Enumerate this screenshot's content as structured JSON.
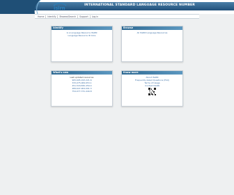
{
  "header": {
    "title": "INTERNATIONAL STANDARD LANGUAGE RESOURCE NUMBER",
    "logo_text": "islrn"
  },
  "nav": {
    "items": [
      "Home",
      "Identify",
      "Browse/Search",
      "Support",
      "Log in"
    ]
  },
  "panels": {
    "identify": {
      "title": "Identify",
      "lines": [
        "Is a Language Resource ISLRN",
        "Language Resource ID links"
      ]
    },
    "browse": {
      "title": "Browse",
      "lines": [
        "All ISLRN Language Resources"
      ]
    },
    "whats_new": {
      "title": "What's new",
      "lines": [
        "Last updated resources",
        "905-695-193-221-6",
        "333-075-069-653-1",
        "451-518-830-459-4",
        "489-647-904-091-3",
        "754-077-731-440-8"
      ]
    },
    "know_more": {
      "title": "Know more",
      "lines": [
        "About ISLRN",
        "Frequently Asked Questions (FAQ)",
        "Terms of Usage",
        "Contact ISLRN"
      ]
    }
  }
}
